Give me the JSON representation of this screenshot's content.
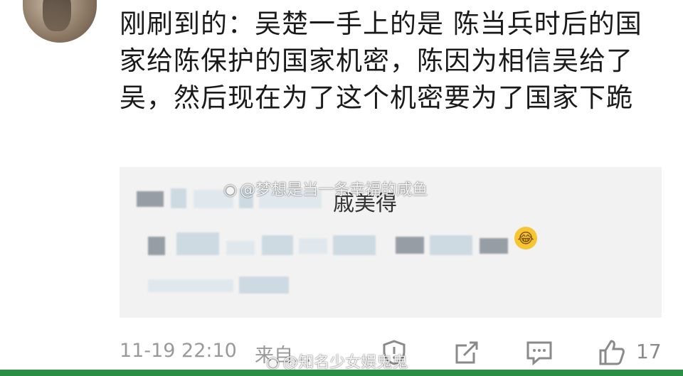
{
  "comment": {
    "text": "刚刷到的：吴楚一手上的是 陈当兵时后的国家给陈保护的国家机密，陈因为相信吴给了吴，然后现在为了这个机密要为了国家下跪"
  },
  "quote": {
    "line1": "戚美得",
    "emoji": "😂"
  },
  "watermarks": {
    "top": "@梦想是当一条幸福的咸鱼",
    "bottom": "@知名少女娱鬼鬼"
  },
  "footer": {
    "timestamp": "11-19 22:10",
    "source": "来自...",
    "like_count": "17"
  },
  "icons": {
    "report": "shield-icon",
    "share": "share-icon",
    "comment": "comment-icon",
    "like": "thumbs-up-icon"
  }
}
